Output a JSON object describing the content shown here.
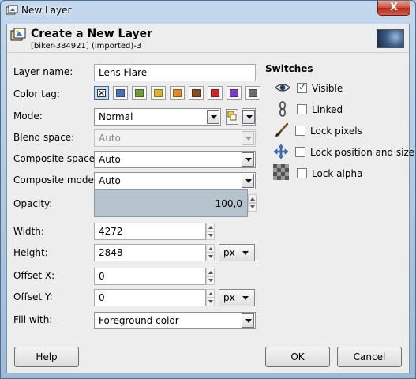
{
  "window": {
    "title": "New Layer",
    "close_label": "X"
  },
  "header": {
    "title": "Create a New Layer",
    "subtitle": "[biker-384921] (imported)-3"
  },
  "form": {
    "layer_name_label": "Layer name:",
    "layer_name_value": "Lens Flare",
    "color_tag_label": "Color tag:",
    "color_tags": [
      "none",
      "blue",
      "green",
      "yellow",
      "orange",
      "brown",
      "red",
      "violet",
      "gray"
    ],
    "color_tag_colors": [
      "#ffffff",
      "#4a6fb8",
      "#6f9a3a",
      "#d8b52a",
      "#e08a2c",
      "#8a4a22",
      "#c8282a",
      "#7c3ec0",
      "#6e6e6e"
    ],
    "mode_label": "Mode:",
    "mode_value": "Normal",
    "blend_space_label": "Blend space:",
    "blend_space_value": "Auto",
    "composite_space_label": "Composite space:",
    "composite_space_value": "Auto",
    "composite_mode_label": "Composite mode:",
    "composite_mode_value": "Auto",
    "opacity_label": "Opacity:",
    "opacity_value": "100,0",
    "width_label": "Width:",
    "width_value": "4272",
    "height_label": "Height:",
    "height_value": "2848",
    "size_unit": "px",
    "offset_x_label": "Offset X:",
    "offset_x_value": "0",
    "offset_y_label": "Offset Y:",
    "offset_y_value": "0",
    "offset_unit": "px",
    "fill_label": "Fill with:",
    "fill_value": "Foreground color"
  },
  "switches": {
    "title": "Switches",
    "visible_label": "Visible",
    "visible_checked": true,
    "linked_label": "Linked",
    "linked_checked": false,
    "lock_pixels_label": "Lock pixels",
    "lock_pixels_checked": false,
    "lock_position_label": "Lock position and size",
    "lock_position_checked": false,
    "lock_alpha_label": "Lock alpha",
    "lock_alpha_checked": false
  },
  "buttons": {
    "help": "Help",
    "ok": "OK",
    "cancel": "Cancel"
  },
  "icons": {
    "app": "gimp-layer-icon",
    "header": "new-layer-icon",
    "visible": "eye-icon",
    "linked": "chain-icon",
    "lock_pixels": "paintbrush-icon",
    "lock_position": "move-arrows-icon",
    "lock_alpha": "checkerboard-icon",
    "mode_switch": "mode-switch-icon"
  }
}
